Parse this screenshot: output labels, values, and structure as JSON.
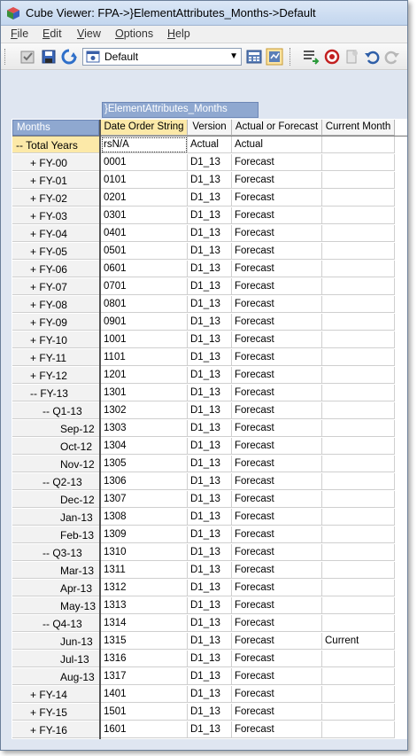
{
  "window": {
    "title": "Cube Viewer: FPA->}ElementAttributes_Months->Default"
  },
  "menu": [
    {
      "underline": "F",
      "rest": "ile"
    },
    {
      "underline": "E",
      "rest": "dit"
    },
    {
      "underline": "V",
      "rest": "iew"
    },
    {
      "underline": "O",
      "rest": "ptions"
    },
    {
      "underline": "H",
      "rest": "elp"
    }
  ],
  "toolbar": {
    "view_name": "Default",
    "icons": [
      "checkbox-icon",
      "save-icon",
      "recalculate-icon",
      "view-icon",
      "calculator-icon",
      "options-icon",
      "export-icon",
      "stop-icon",
      "sandbox-icon",
      "undo-icon",
      "redo-icon"
    ]
  },
  "dimensions": {
    "column": "}ElementAttributes_Months",
    "row": "Months"
  },
  "columns": [
    "Date Order String",
    "Version",
    "Actual or Forecast",
    "Current Month"
  ],
  "rows": [
    {
      "label": "Total Years",
      "sym": "--",
      "indent": 0,
      "sel": true,
      "cells": [
        "rsN/A",
        "Actual",
        "Actual",
        ""
      ]
    },
    {
      "label": "FY-00",
      "sym": "+",
      "indent": 1,
      "cells": [
        "0001",
        "D1_13",
        "Forecast",
        ""
      ]
    },
    {
      "label": "FY-01",
      "sym": "+",
      "indent": 1,
      "cells": [
        "0101",
        "D1_13",
        "Forecast",
        ""
      ]
    },
    {
      "label": "FY-02",
      "sym": "+",
      "indent": 1,
      "cells": [
        "0201",
        "D1_13",
        "Forecast",
        ""
      ]
    },
    {
      "label": "FY-03",
      "sym": "+",
      "indent": 1,
      "cells": [
        "0301",
        "D1_13",
        "Forecast",
        ""
      ]
    },
    {
      "label": "FY-04",
      "sym": "+",
      "indent": 1,
      "cells": [
        "0401",
        "D1_13",
        "Forecast",
        ""
      ]
    },
    {
      "label": "FY-05",
      "sym": "+",
      "indent": 1,
      "cells": [
        "0501",
        "D1_13",
        "Forecast",
        ""
      ]
    },
    {
      "label": "FY-06",
      "sym": "+",
      "indent": 1,
      "cells": [
        "0601",
        "D1_13",
        "Forecast",
        ""
      ]
    },
    {
      "label": "FY-07",
      "sym": "+",
      "indent": 1,
      "cells": [
        "0701",
        "D1_13",
        "Forecast",
        ""
      ]
    },
    {
      "label": "FY-08",
      "sym": "+",
      "indent": 1,
      "cells": [
        "0801",
        "D1_13",
        "Forecast",
        ""
      ]
    },
    {
      "label": "FY-09",
      "sym": "+",
      "indent": 1,
      "cells": [
        "0901",
        "D1_13",
        "Forecast",
        ""
      ]
    },
    {
      "label": "FY-10",
      "sym": "+",
      "indent": 1,
      "cells": [
        "1001",
        "D1_13",
        "Forecast",
        ""
      ]
    },
    {
      "label": "FY-11",
      "sym": "+",
      "indent": 1,
      "cells": [
        "1101",
        "D1_13",
        "Forecast",
        ""
      ]
    },
    {
      "label": "FY-12",
      "sym": "+",
      "indent": 1,
      "cells": [
        "1201",
        "D1_13",
        "Forecast",
        ""
      ]
    },
    {
      "label": "FY-13",
      "sym": "--",
      "indent": 1,
      "cells": [
        "1301",
        "D1_13",
        "Forecast",
        ""
      ]
    },
    {
      "label": "Q1-13",
      "sym": "--",
      "indent": 2,
      "cells": [
        "1302",
        "D1_13",
        "Forecast",
        ""
      ]
    },
    {
      "label": "Sep-12",
      "sym": "",
      "indent": 3,
      "cells": [
        "1303",
        "D1_13",
        "Forecast",
        ""
      ]
    },
    {
      "label": "Oct-12",
      "sym": "",
      "indent": 3,
      "cells": [
        "1304",
        "D1_13",
        "Forecast",
        ""
      ]
    },
    {
      "label": "Nov-12",
      "sym": "",
      "indent": 3,
      "cells": [
        "1305",
        "D1_13",
        "Forecast",
        ""
      ]
    },
    {
      "label": "Q2-13",
      "sym": "--",
      "indent": 2,
      "cells": [
        "1306",
        "D1_13",
        "Forecast",
        ""
      ]
    },
    {
      "label": "Dec-12",
      "sym": "",
      "indent": 3,
      "cells": [
        "1307",
        "D1_13",
        "Forecast",
        ""
      ]
    },
    {
      "label": "Jan-13",
      "sym": "",
      "indent": 3,
      "cells": [
        "1308",
        "D1_13",
        "Forecast",
        ""
      ]
    },
    {
      "label": "Feb-13",
      "sym": "",
      "indent": 3,
      "cells": [
        "1309",
        "D1_13",
        "Forecast",
        ""
      ]
    },
    {
      "label": "Q3-13",
      "sym": "--",
      "indent": 2,
      "cells": [
        "1310",
        "D1_13",
        "Forecast",
        ""
      ]
    },
    {
      "label": "Mar-13",
      "sym": "",
      "indent": 3,
      "cells": [
        "1311",
        "D1_13",
        "Forecast",
        ""
      ]
    },
    {
      "label": "Apr-13",
      "sym": "",
      "indent": 3,
      "cells": [
        "1312",
        "D1_13",
        "Forecast",
        ""
      ]
    },
    {
      "label": "May-13",
      "sym": "",
      "indent": 3,
      "cells": [
        "1313",
        "D1_13",
        "Forecast",
        ""
      ]
    },
    {
      "label": "Q4-13",
      "sym": "--",
      "indent": 2,
      "cells": [
        "1314",
        "D1_13",
        "Forecast",
        ""
      ]
    },
    {
      "label": "Jun-13",
      "sym": "",
      "indent": 3,
      "cells": [
        "1315",
        "D1_13",
        "Forecast",
        "Current"
      ]
    },
    {
      "label": "Jul-13",
      "sym": "",
      "indent": 3,
      "cells": [
        "1316",
        "D1_13",
        "Forecast",
        ""
      ]
    },
    {
      "label": "Aug-13",
      "sym": "",
      "indent": 3,
      "cells": [
        "1317",
        "D1_13",
        "Forecast",
        ""
      ]
    },
    {
      "label": "FY-14",
      "sym": "+",
      "indent": 1,
      "cells": [
        "1401",
        "D1_13",
        "Forecast",
        ""
      ]
    },
    {
      "label": "FY-15",
      "sym": "+",
      "indent": 1,
      "cells": [
        "1501",
        "D1_13",
        "Forecast",
        ""
      ]
    },
    {
      "label": "FY-16",
      "sym": "+",
      "indent": 1,
      "cells": [
        "1601",
        "D1_13",
        "Forecast",
        ""
      ]
    }
  ]
}
